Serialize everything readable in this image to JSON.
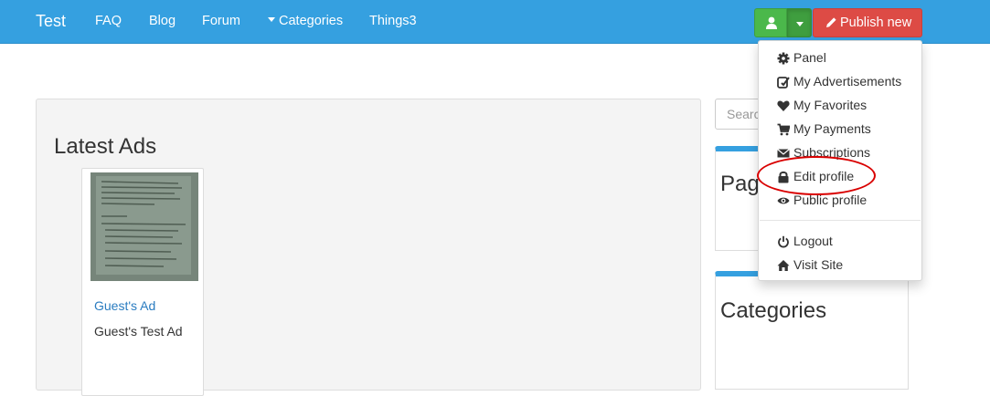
{
  "navbar": {
    "brand": "Test",
    "links": [
      "FAQ",
      "Blog",
      "Forum",
      "Categories",
      "Things3"
    ],
    "publish_label": "Publish new",
    "colors": {
      "bar": "#35a0e0",
      "user_button": "#4bb84b",
      "publish_button": "#dd4b45"
    }
  },
  "main": {
    "section_title": "Latest Ads",
    "ads": [
      {
        "title": "Guest's Ad",
        "description": "Guest's Test Ad"
      }
    ]
  },
  "sidebar": {
    "search_placeholder": "Search",
    "widget_1_title": "Pag",
    "widget_2_title": "Categories"
  },
  "user_menu": {
    "items": [
      {
        "label": "Panel",
        "icon": "gear-icon"
      },
      {
        "label": "My Advertisements",
        "icon": "edit-icon"
      },
      {
        "label": "My Favorites",
        "icon": "heart-icon"
      },
      {
        "label": "My Payments",
        "icon": "cart-icon"
      },
      {
        "label": "Subscriptions",
        "icon": "envelope-icon"
      },
      {
        "label": "Edit profile",
        "icon": "lock-icon"
      },
      {
        "label": "Public profile",
        "icon": "eye-icon"
      }
    ],
    "secondary_items": [
      {
        "label": "Logout",
        "icon": "power-icon"
      },
      {
        "label": "Visit Site",
        "icon": "home-icon"
      }
    ]
  }
}
